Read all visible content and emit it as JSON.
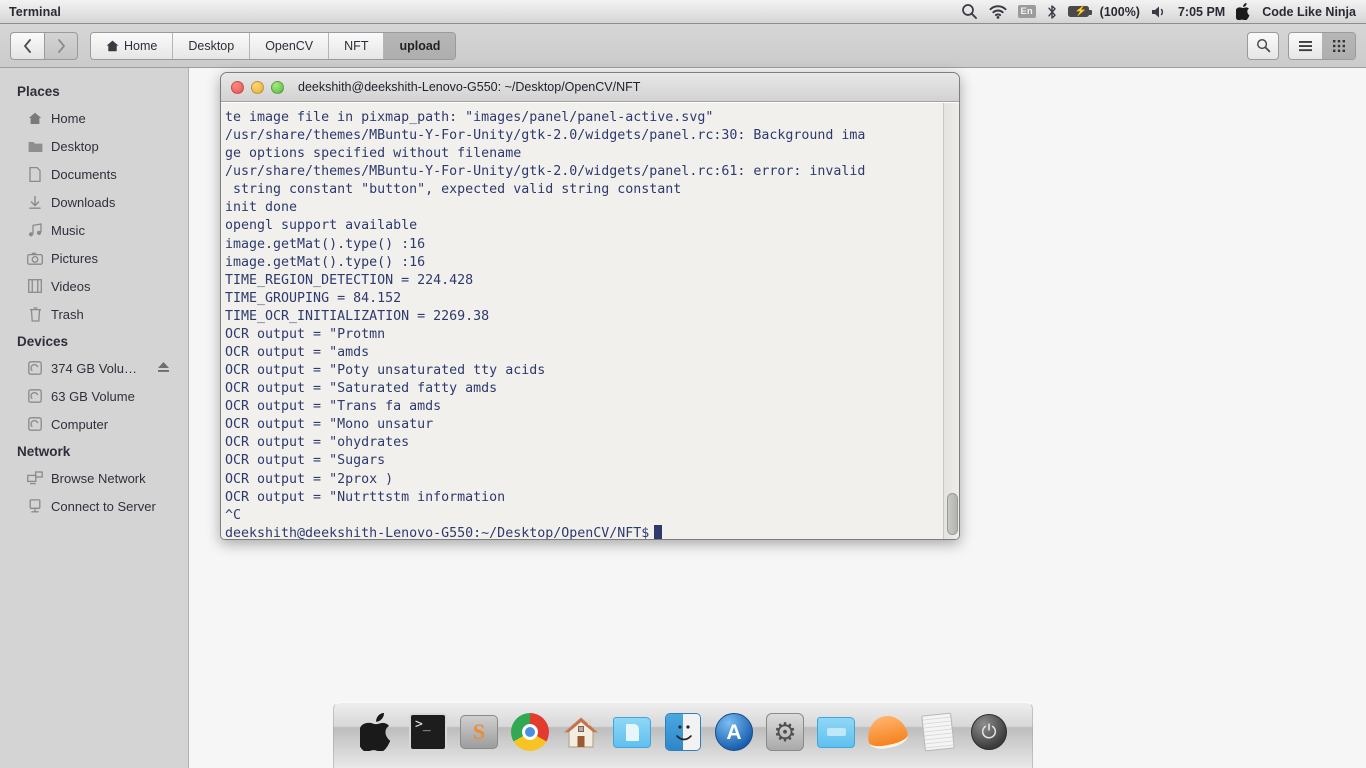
{
  "menubar": {
    "app_title": "Terminal",
    "tray": {
      "search_icon": "search-icon",
      "wifi_icon": "wifi-icon",
      "language": "En",
      "bluetooth_icon": "bluetooth-icon",
      "battery_icon": "battery-icon",
      "battery_percent": "(100%)",
      "volume_icon": "volume-icon",
      "clock": "7:05 PM",
      "apple_icon": "apple-logo-icon",
      "user": "Code Like Ninja"
    }
  },
  "toolbar": {
    "back_icon": "chevron-left-icon",
    "forward_icon": "chevron-right-icon",
    "search_icon": "search-icon",
    "list_view_icon": "list-view-icon",
    "grid_view_icon": "grid-view-icon",
    "breadcrumbs": [
      {
        "label": "Home",
        "icon": "home-icon",
        "active": false
      },
      {
        "label": "Desktop",
        "icon": "",
        "active": false
      },
      {
        "label": "OpenCV",
        "icon": "",
        "active": false
      },
      {
        "label": "NFT",
        "icon": "",
        "active": false
      },
      {
        "label": "upload",
        "icon": "",
        "active": true
      }
    ]
  },
  "sidebar": {
    "sections": [
      {
        "title": "Places",
        "items": [
          {
            "label": "Home",
            "icon": "home-icon",
            "glyph": "⌂",
            "eject": false
          },
          {
            "label": "Desktop",
            "icon": "folder-icon",
            "glyph": "▤",
            "eject": false
          },
          {
            "label": "Documents",
            "icon": "document-icon",
            "glyph": "▭",
            "eject": false
          },
          {
            "label": "Downloads",
            "icon": "download-icon",
            "glyph": "↧",
            "eject": false
          },
          {
            "label": "Music",
            "icon": "music-note-icon",
            "glyph": "♫",
            "eject": false
          },
          {
            "label": "Pictures",
            "icon": "camera-icon",
            "glyph": "◉",
            "eject": false
          },
          {
            "label": "Videos",
            "icon": "film-icon",
            "glyph": "⌸",
            "eject": false
          },
          {
            "label": "Trash",
            "icon": "trash-icon",
            "glyph": "⌧",
            "eject": false
          }
        ]
      },
      {
        "title": "Devices",
        "items": [
          {
            "label": "374 GB Volu…",
            "icon": "disk-icon",
            "glyph": "▣",
            "eject": true,
            "eject_glyph": "⏏"
          },
          {
            "label": "63 GB Volume",
            "icon": "disk-icon",
            "glyph": "▣",
            "eject": false
          },
          {
            "label": "Computer",
            "icon": "disk-icon",
            "glyph": "▣",
            "eject": false
          }
        ]
      },
      {
        "title": "Network",
        "items": [
          {
            "label": "Browse Network",
            "icon": "network-icon",
            "glyph": "☷",
            "eject": false
          },
          {
            "label": "Connect to Server",
            "icon": "server-icon",
            "glyph": "▯",
            "eject": false
          }
        ]
      }
    ]
  },
  "terminal": {
    "title": "deekshith@deekshith-Lenovo-G550: ~/Desktop/OpenCV/NFT",
    "close_icon": "close-window-icon",
    "minimize_icon": "minimize-window-icon",
    "maximize_icon": "maximize-window-icon",
    "scrollbar_icon": "vertical-scrollbar",
    "output": "te image file in pixmap_path: \"images/panel/panel-active.svg\"\n/usr/share/themes/MBuntu-Y-For-Unity/gtk-2.0/widgets/panel.rc:30: Background ima\nge options specified without filename\n/usr/share/themes/MBuntu-Y-For-Unity/gtk-2.0/widgets/panel.rc:61: error: invalid\n string constant \"button\", expected valid string constant\ninit done\nopengl support available\nimage.getMat().type() :16\nimage.getMat().type() :16\nTIME_REGION_DETECTION = 224.428\nTIME_GROUPING = 84.152\nTIME_OCR_INITIALIZATION = 2269.38\nOCR output = \"Protmn\nOCR output = \"amds\nOCR output = \"Poty unsaturated tty acids\nOCR output = \"Saturated fatty amds\nOCR output = \"Trans fa amds\nOCR output = \"Mono unsatur\nOCR output = \"ohydrates\nOCR output = \"Sugars\nOCR output = \"2prox )\nOCR output = \"Nutrttstm information\n^C",
    "prompt": "deekshith@deekshith-Lenovo-G550:~/Desktop/OpenCV/NFT$"
  },
  "dock": {
    "items": [
      {
        "name": "apple-icon",
        "label": "Apple"
      },
      {
        "name": "terminal-icon",
        "label": "Terminal"
      },
      {
        "name": "sublime-text-icon",
        "label": "Sublime Text"
      },
      {
        "name": "chrome-icon",
        "label": "Google Chrome"
      },
      {
        "name": "home-icon",
        "label": "Home"
      },
      {
        "name": "documents-folder-icon",
        "label": "Documents"
      },
      {
        "name": "finder-icon",
        "label": "Finder"
      },
      {
        "name": "app-store-icon",
        "label": "App Store"
      },
      {
        "name": "system-settings-icon",
        "label": "System Settings"
      },
      {
        "name": "folder-icon",
        "label": "Files"
      },
      {
        "name": "clementine-icon",
        "label": "Clementine"
      },
      {
        "name": "notes-icon",
        "label": "Notes"
      },
      {
        "name": "power-icon",
        "label": "Power"
      }
    ],
    "terminal_glyph": ">_",
    "sublime_glyph": "S",
    "apple_glyph": "",
    "house_glyph": "🏠",
    "appstore_glyph": "A",
    "settings_glyph": "⚙",
    "power_glyph": "⏻"
  },
  "colors": {
    "menubar_text": "#2a2a35",
    "terminal_text": "#2e3a6e",
    "terminal_bg": "#f1f0ec",
    "sidebar_bg": "#d4d4d4",
    "toolbar_bg": "#cdcdcd",
    "accent_active": "#b2b2b2"
  }
}
